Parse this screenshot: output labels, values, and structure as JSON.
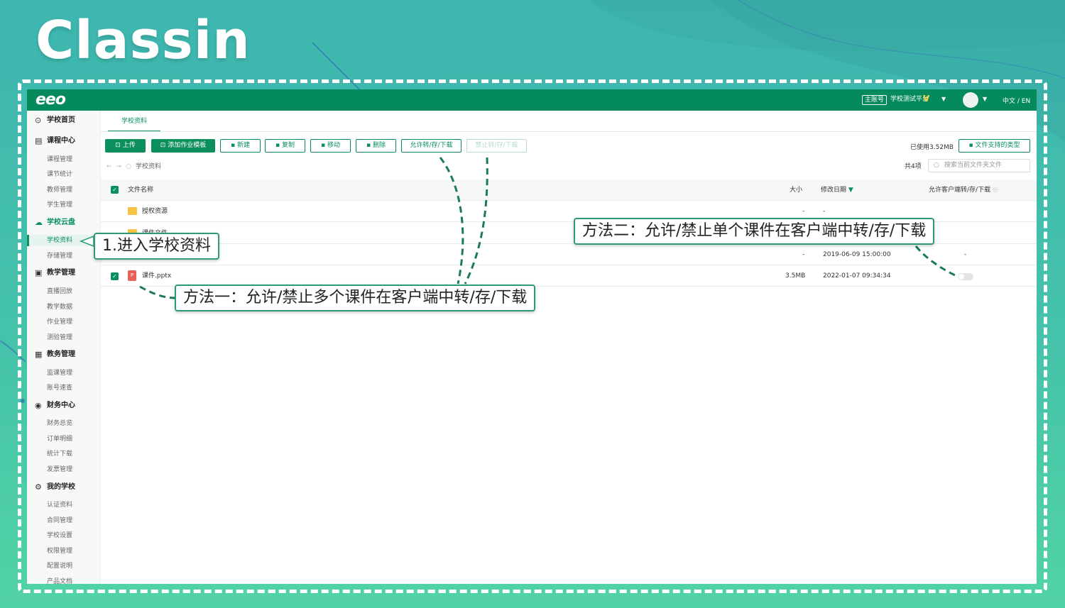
{
  "brand": {
    "logo_text": "Classin"
  },
  "topbar": {
    "logo": "eeo",
    "account_badge": "主账号",
    "school_name": "学校测试平台",
    "vip_mark": "V",
    "language": "中文 / EN"
  },
  "sidebar": {
    "items": [
      {
        "label": "学校首页",
        "type": "group",
        "icon": "clock-icon"
      },
      {
        "label": "课程中心",
        "type": "group",
        "icon": "calendar-icon"
      },
      {
        "label": "课程管理",
        "type": "item"
      },
      {
        "label": "课节统计",
        "type": "item"
      },
      {
        "label": "教师管理",
        "type": "item"
      },
      {
        "label": "学生管理",
        "type": "item"
      },
      {
        "label": "学校云盘",
        "type": "group",
        "icon": "cloud-icon"
      },
      {
        "label": "学校资料",
        "type": "item",
        "active": true
      },
      {
        "label": "存储管理",
        "type": "item"
      },
      {
        "label": "教学管理",
        "type": "group",
        "icon": "monitor-icon"
      },
      {
        "label": "直播回放",
        "type": "item"
      },
      {
        "label": "教学数据",
        "type": "item"
      },
      {
        "label": "作业管理",
        "type": "item"
      },
      {
        "label": "测验管理",
        "type": "item"
      },
      {
        "label": "教务管理",
        "type": "group",
        "icon": "grid-icon"
      },
      {
        "label": "监课管理",
        "type": "item"
      },
      {
        "label": "账号速查",
        "type": "item"
      },
      {
        "label": "财务中心",
        "type": "group",
        "icon": "coin-icon"
      },
      {
        "label": "财务总览",
        "type": "item"
      },
      {
        "label": "订单明细",
        "type": "item"
      },
      {
        "label": "统计下载",
        "type": "item"
      },
      {
        "label": "发票管理",
        "type": "item"
      },
      {
        "label": "我的学校",
        "type": "group",
        "icon": "settings-icon"
      },
      {
        "label": "认证资料",
        "type": "item"
      },
      {
        "label": "合同管理",
        "type": "item"
      },
      {
        "label": "学校设置",
        "type": "item"
      },
      {
        "label": "权限管理",
        "type": "item"
      },
      {
        "label": "配置说明",
        "type": "item"
      },
      {
        "label": "产品文档",
        "type": "item"
      }
    ]
  },
  "main": {
    "tab": "学校资料",
    "toolbar": {
      "upload": "上传",
      "add_template": "添加作业模板",
      "new": "新建",
      "copy": "复制",
      "move": "移动",
      "delete": "删除",
      "allow": "允许转/存/下载",
      "forbid": "禁止转/存/下载"
    },
    "storage_used": "已使用3.52MB",
    "supported_types": "文件支持的类型",
    "breadcrumb": "学校资料",
    "total_count": "共4项",
    "search_placeholder": "搜索当前文件夹文件",
    "table": {
      "headers": {
        "name": "文件名称",
        "size": "大小",
        "modified": "修改日期",
        "client_permission": "允许客户端转/存/下载"
      },
      "rows": [
        {
          "name": "授权资源",
          "type": "folder",
          "size": "-",
          "modified": "-",
          "permission": "-"
        },
        {
          "name": "课件文件",
          "type": "folder",
          "size": "-",
          "modified": "-",
          "permission": "-"
        },
        {
          "name": "",
          "type": "folder",
          "size": "-",
          "modified": "2019-06-09 15:00:00",
          "permission": "-"
        },
        {
          "name": "课件.pptx",
          "type": "pptx",
          "size": "3.5MB",
          "modified": "2022-01-07 09:34:34",
          "permission": "toggle-off"
        }
      ]
    }
  },
  "callouts": {
    "step1": "1.进入学校资料",
    "method1": "方法一：允许/禁止多个课件在客户端中转/存/下载",
    "method2": "方法二：允许/禁止单个课件在客户端中转/存/下载"
  },
  "colors": {
    "brand_green": "#0a8f5d",
    "topbar_green": "#048a5b",
    "background_teal": "#3db6b0",
    "folder_yellow": "#f6c343",
    "pptx_red": "#e8615a"
  }
}
